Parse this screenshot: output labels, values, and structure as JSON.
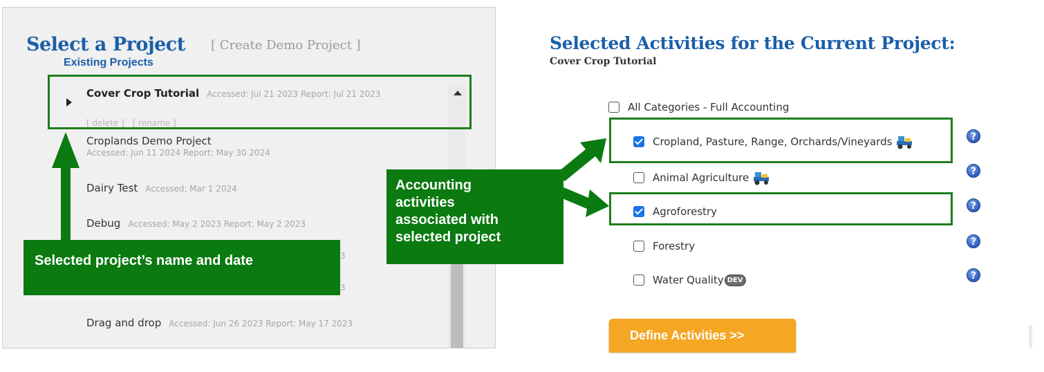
{
  "left_panel": {
    "title": "Select a Project",
    "create_demo": "[ Create Demo Project ]",
    "existing_label": "Existing Projects",
    "projects": [
      {
        "name": "Cover Crop Tutorial",
        "meta": "Accessed: Jul 21 2023 Report: Jul 21 2023"
      },
      {
        "name": "Croplands Demo Project",
        "meta": "Accessed: Jun 11 2024 Report: May 30 2024"
      },
      {
        "name": "Dairy Test",
        "meta": "Accessed: Mar 1 2024"
      },
      {
        "name": "Debug",
        "meta": "Accessed: May 2 2023 Report: May 2 2023"
      },
      {
        "name": "Drag and drop",
        "meta": "Accessed: Jun 26 2023 Report: May 17 2023"
      }
    ],
    "delete_label": "[ delete ]",
    "rename_label": "[ rename ]",
    "hidden_meta_end_1": "3",
    "hidden_meta_end_2": "3"
  },
  "annotations": {
    "left_callout": "Selected project’s name and date",
    "right_callout_lines": [
      "Accounting",
      "activities",
      "associated with",
      "selected project"
    ],
    "color": "#0b7a11"
  },
  "right_panel": {
    "title": "Selected Activities for the Current Project:",
    "subtitle": "Cover Crop Tutorial",
    "categories": [
      {
        "label": "All Categories - Full Accounting",
        "checked": false
      },
      {
        "label": "Cropland, Pasture, Range, Orchards/Vineyards",
        "checked": true,
        "icon": "tractor-icon"
      },
      {
        "label": "Animal Agriculture",
        "checked": false,
        "icon": "tractor-icon"
      },
      {
        "label": "Agroforestry",
        "checked": true
      },
      {
        "label": "Forestry",
        "checked": false
      },
      {
        "label": "Water Quality",
        "checked": false,
        "badge": "DEV"
      }
    ],
    "help_symbol": "?",
    "define_button": "Define Activities >>"
  },
  "colors": {
    "title_blue": "#1b5fa8",
    "highlight_green": "#1e7d1e",
    "button_orange": "#f5a623",
    "checkbox_blue": "#1a73e8"
  }
}
